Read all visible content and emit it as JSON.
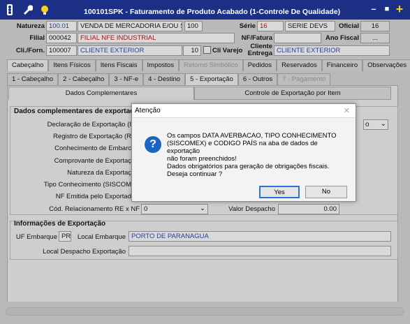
{
  "window": {
    "title": "100101SPK - Faturamento de Produto Acabado (1-Controle De Qualidade)",
    "minimize": "–",
    "maximize": "■",
    "close": "+"
  },
  "header": {
    "natureza_label": "Natureza",
    "natureza_code": "100.01",
    "natureza_desc": "VENDA DE MERCADORIA E/OU SERVI",
    "natureza_num": "100",
    "serie_label": "Série",
    "serie_value": "16",
    "serie_desc": "SERIE DEVS",
    "oficial_label": "Oficial",
    "oficial_value": "16",
    "filial_label": "Filial",
    "filial_code": "000042",
    "filial_desc": "FILIAL NFE INDUSTRIAL",
    "nffatura_label": "NF/Fatura",
    "nffatura_value": "",
    "anofiscal_label": "Ano Fiscal",
    "anofiscal_value": "...",
    "cli_label": "Cli./Forn.",
    "cli_code": "100007",
    "cli_desc": "CLIENTE EXTERIOR",
    "cli_num": "10",
    "varejo_label": "Cli Varejo",
    "entrega_label1": "Cliente",
    "entrega_label2": "Entrega",
    "entrega_value": "CLIENTE EXTERIOR"
  },
  "tabs_main": [
    "Cabeçalho",
    "Itens Físicos",
    "Itens Fiscais",
    "Impostos",
    "Retorno Simbólico",
    "Pedidos",
    "Reservados",
    "Financeiro",
    "Observações"
  ],
  "tabs_sub": [
    "1 - Cabeçalho",
    "2 - Cabeçalho",
    "3 - NF-e",
    "4 - Destino",
    "5 - Exportação",
    "6 - Outros",
    "7 - Pagamento"
  ],
  "tabs_export": [
    "Dados Complementares",
    "Controle de Exportação por Item"
  ],
  "dados": {
    "group_title": "Dados complementares de exportaç",
    "rows": [
      "Declaração de Exportação (I",
      "Registro de Exportação (R",
      "Conhecimento de Embarc",
      "Comprovante de Exportaç",
      "Natureza da Exportaç",
      "Tipo Conhecimento (SISCOM",
      "NF Emitida pelo Exportad"
    ],
    "relac_label": "Cód. Relacionamento RE x NF",
    "relac_value": "0",
    "despacho_label": "Valor Despacho",
    "despacho_value": "0.00"
  },
  "info": {
    "group_title": "Informações de Exportação",
    "uf_label": "UF Embarque",
    "uf_value": "PR",
    "local_label": "Local Embarque",
    "local_value": "PORTO DE PARANAGUA",
    "despacho_local_label": "Local Despacho Exportação",
    "despacho_local_value": ""
  },
  "dialog": {
    "title": "Atenção",
    "close": "✕",
    "message": "Os campos DATA AVERBACAO, TIPO CONHECIMENTO\n(SISCOMEX) e CODIGO PAÍS na aba de dados de exportação\nnão foram preenchidos!\nDados obrigatórios para geração de obrigações fiscais.\nDeseja continuar ?",
    "yes": "Yes",
    "no": "No"
  },
  "colors": {
    "titlebar": "#1b2f86",
    "accent": "#1c64c4",
    "red_text": "#c00000",
    "blue_text": "#1a3aa8"
  }
}
